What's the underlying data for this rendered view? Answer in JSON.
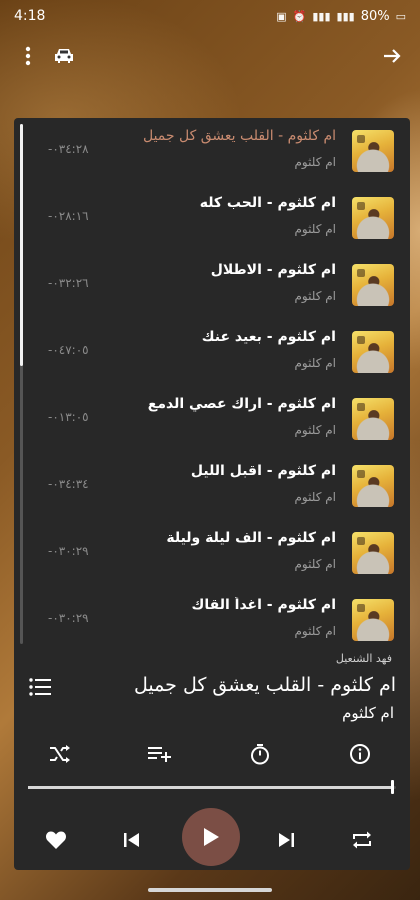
{
  "status": {
    "time": "4:18",
    "battery": "80%"
  },
  "queue": [
    {
      "title": "ام كلثوم - القلب يعشق كل جميل",
      "artist": "ام كلثوم",
      "duration": "-٠٣٤:٢٨",
      "active": true
    },
    {
      "title": "ام كلثوم - الحب كله",
      "artist": "ام كلثوم",
      "duration": "-٠٢٨:١٦",
      "active": false
    },
    {
      "title": "ام كلثوم - الاطلال",
      "artist": "ام كلثوم",
      "duration": "-٠٣٢:٢٦",
      "active": false
    },
    {
      "title": "ام كلثوم - بعيد عنك",
      "artist": "ام كلثوم",
      "duration": "-٠٤٧:٠٥",
      "active": false
    },
    {
      "title": "ام كلثوم - اراك عصي الدمع",
      "artist": "ام كلثوم",
      "duration": "-٠١٣:٠٥",
      "active": false
    },
    {
      "title": "ام كلثوم - اقبل الليل",
      "artist": "ام كلثوم",
      "duration": "-٠٣٤:٣٤",
      "active": false
    },
    {
      "title": "ام كلثوم - الف ليلة وليلة",
      "artist": "ام كلثوم",
      "duration": "-٠٣٠:٢٩",
      "active": false
    },
    {
      "title": "ام كلثوم - اغداً القاك",
      "artist": "ام كلثوم",
      "duration": "-٠٣٠:٢٩",
      "active": false
    }
  ],
  "now_playing": {
    "source": "فهد الشنعيل",
    "title": "ام كلثوم - القلب يعشق كل جميل",
    "artist": "ام كلثوم",
    "progress": 0.99
  },
  "colors": {
    "accent": "#c98b70",
    "play_button": "#7b4e45",
    "panel": "#282828"
  },
  "icons": {
    "menu": "more-vert-icon",
    "car": "car-icon",
    "forward": "arrow-forward-icon",
    "queue": "queue-list-icon",
    "shuffle": "shuffle-icon",
    "playlist_add": "playlist-add-icon",
    "timer": "timer-icon",
    "info": "info-icon",
    "favorite": "heart-icon",
    "previous": "skip-previous-icon",
    "play": "play-icon",
    "next": "skip-next-icon",
    "repeat": "repeat-icon"
  }
}
